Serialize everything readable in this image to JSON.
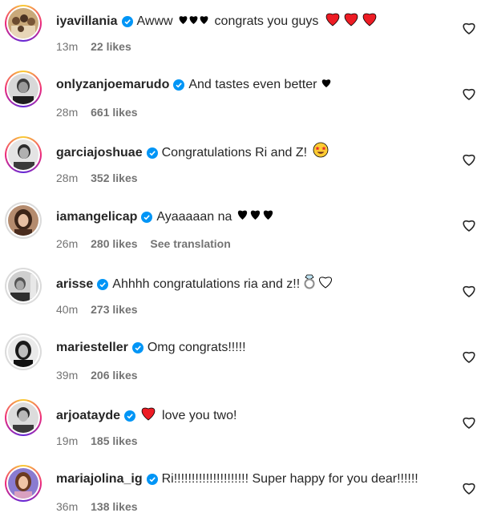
{
  "comments": [
    {
      "username": "iyavillania",
      "text": "Awww",
      "text_after": "congrats you guys",
      "time": "13m",
      "likes": "22 likes",
      "prefix_hearts": "black",
      "suffix_hearts": "red",
      "avatar": "group-photo"
    },
    {
      "username": "onlyzanjoemarudo",
      "text": "And tastes even better",
      "time": "28m",
      "likes": "661 likes",
      "suffix_hearts": "black-single",
      "avatar": "man-portrait-bw"
    },
    {
      "username": "garciajoshuae",
      "text": "Congratulations Ri and Z!",
      "time": "28m",
      "likes": "352 likes",
      "suffix_emoji": "star-struck-face",
      "avatar": "man-portrait-bw"
    },
    {
      "username": "iamangelicap",
      "text": "Ayaaaaan na",
      "time": "26m",
      "likes": "280 likes",
      "see_translation": "See translation",
      "suffix_hearts": "black",
      "avatar": "woman-portrait"
    },
    {
      "username": "arisse",
      "text": "Ahhhh congratulations ria and z!!",
      "time": "40m",
      "likes": "273 likes",
      "suffix_emoji": "ring-and-white-heart",
      "avatar": "man-portrait-bw"
    },
    {
      "username": "mariesteller",
      "text": "Omg congrats!!!!!",
      "time": "39m",
      "likes": "206 likes",
      "avatar": "woman-portrait-bw"
    },
    {
      "username": "arjoatayde",
      "text": "love you two!",
      "time": "19m",
      "likes": "185 likes",
      "prefix_emoji": "red-heart",
      "avatar": "man-portrait-bw"
    },
    {
      "username": "mariajolina_ig",
      "text": "Ri!!!!!!!!!!!!!!!!!!!!! Super happy for you dear!!!!!!",
      "time": "36m",
      "likes": "138 likes",
      "avatar": "woman-portrait-color"
    }
  ],
  "colors": {
    "verified": "#0095f6",
    "red_heart": "#ed1c24",
    "meta_text": "#737373"
  },
  "icons": {
    "verified": "verified-badge-icon",
    "like": "heart-outline-icon"
  }
}
